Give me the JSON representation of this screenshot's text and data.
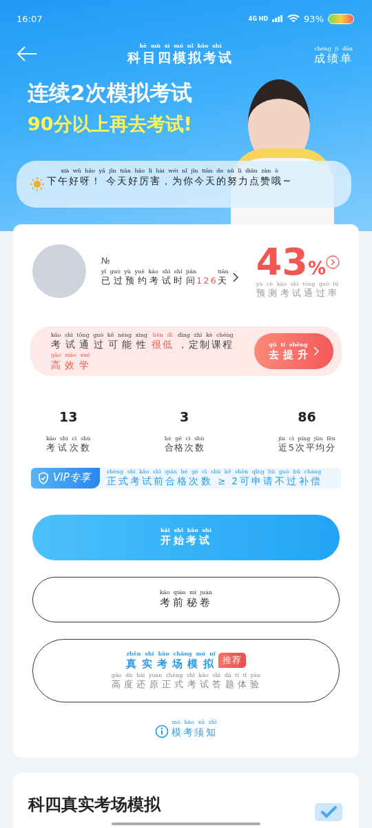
{
  "status_bar": {
    "time": "16:07",
    "network": "4G HD",
    "battery": "93%"
  },
  "header": {
    "title": {
      "text": "科目四模拟考试",
      "pinyin": "kē mù sì mó nǐ kǎo shì"
    },
    "action": {
      "text": "成绩单",
      "pinyin": "chéng jì dān"
    }
  },
  "banner": {
    "line_1": "连续2次模拟考试",
    "line_2": "90分以上再去考试!"
  },
  "greeting": {
    "text": "下午好呀！ 今天好厉害，为你今天的努力点赞哦~",
    "pinyin": "xià wǔ hǎo yā jīn tiān hǎo lì hài wéi nǐ jīn tiān de nǔ lì diǎn zàn ò"
  },
  "profile": {
    "badge": "№",
    "countdown": [
      {
        "text": "已过预约考试时间",
        "pinyin": "yǐ guò yù yuē kǎo shì shí jiān",
        "highlight": false
      },
      {
        "text": " 126 ",
        "highlight": true
      },
      {
        "text": "天",
        "pinyin": "tiān",
        "highlight": false
      }
    ],
    "pass_rate": "43",
    "pass_rate_unit": "%",
    "pass_rate_label": {
      "text": "预测考试通过率",
      "pinyin": "yù cè kǎo shì tōng guò lǜ"
    }
  },
  "tip": {
    "segments": [
      {
        "text": "考试通过可能性",
        "pinyin": "kǎo shì tōng guò kě néng xìng",
        "highlight": false
      },
      {
        "text": "很低",
        "pinyin": "hěn dī",
        "highlight": true
      },
      {
        "text": "，定制课程",
        "pinyin": "dìng zhì kè chéng",
        "highlight": false
      },
      {
        "text": "高效学",
        "pinyin": "gāo xiào xué",
        "highlight": true
      }
    ],
    "button": {
      "text": "去提升",
      "pinyin": "qù tí shēng"
    }
  },
  "stats": [
    {
      "value": "13",
      "label": {
        "text": "考试次数",
        "pinyin": "kǎo shì cì shù"
      }
    },
    {
      "value": "3",
      "label": {
        "text": "合格次数",
        "pinyin": "hé gé cì shù"
      }
    },
    {
      "value": "86",
      "label": {
        "text": "近5次平均分",
        "pinyin": "jìn cì píng jūn fēn"
      }
    }
  ],
  "vip": {
    "badge": "VIP专享",
    "text": "正式考试前合格次数 ≥ 2可申请不过补偿",
    "pinyin": "zhèng shì kǎo shì qián hé gé cì shù kě shēn qǐng bù guò bǔ cháng"
  },
  "buttons": [
    {
      "kind": "primary",
      "title": {
        "text": "开始考试",
        "pinyin": "kāi shǐ kǎo shì"
      }
    },
    {
      "kind": "outline",
      "title": {
        "text": "考前秘卷",
        "pinyin": "kǎo qián mì juàn"
      }
    },
    {
      "kind": "featured",
      "title": {
        "text": "真实考场模拟",
        "pinyin": "zhēn shí kǎo chǎng mó nǐ"
      },
      "tag": "推荐",
      "subtitle": {
        "text": "高度还原正式考试答题体验",
        "pinyin": "gāo dù hái yuán zhèng shì kǎo shì dá tí tǐ yàn"
      }
    }
  ],
  "notice": {
    "text": "模考须知",
    "pinyin": "mó kǎo xū zhī"
  },
  "section": {
    "title": "科四真实考场模拟"
  }
}
